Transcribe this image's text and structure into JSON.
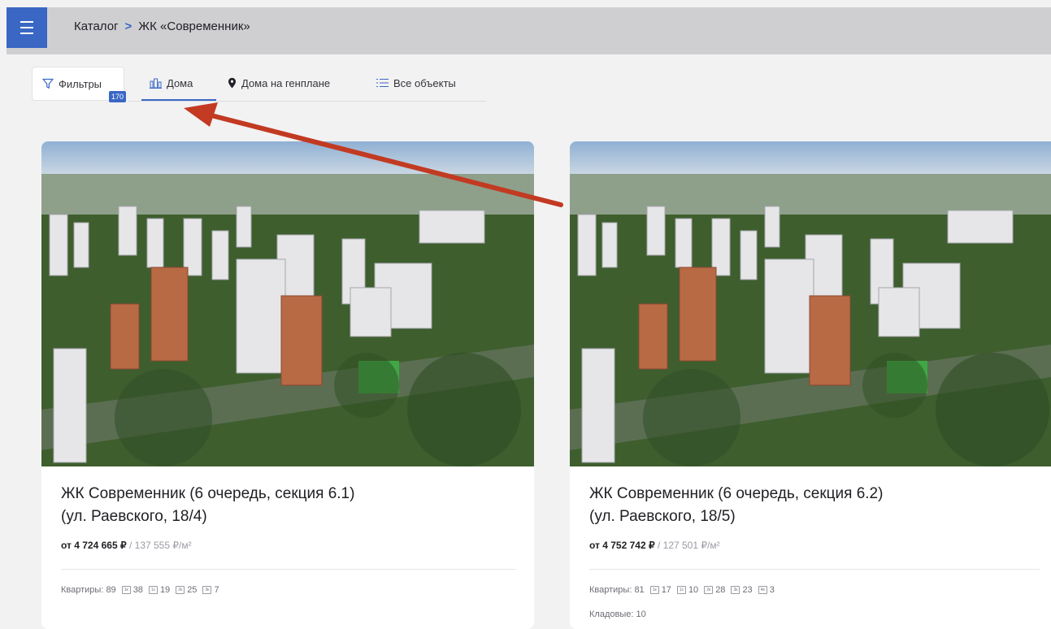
{
  "header": {
    "breadcrumb_catalog": "Каталог",
    "breadcrumb_separator": ">",
    "breadcrumb_current": "ЖК «Современник»"
  },
  "tabs": {
    "filters_label": "Фильтры",
    "filters_count": "170",
    "houses_label": "Дома",
    "genplan_label": "Дома на генплане",
    "all_objects_label": "Все объекты",
    "active_tab": "Дома"
  },
  "cards": [
    {
      "title_line1": "ЖК Современник (6 очередь, секция 6.1)",
      "title_line2": "(ул. Раевского, 18/4)",
      "price": "от 4 724 665 ₽",
      "price_sep": "/",
      "price_sqm": "137 555 ₽/м²",
      "apartments_label": "Квартиры: 89",
      "rooms": [
        {
          "type": "1к",
          "count": "38"
        },
        {
          "type": "1с",
          "count": "19"
        },
        {
          "type": "2к",
          "count": "25"
        },
        {
          "type": "3к",
          "count": "7"
        }
      ]
    },
    {
      "title_line1": "ЖК Современник (6 очередь, секция 6.2)",
      "title_line2": "(ул. Раевского, 18/5)",
      "price": "от 4 752 742 ₽",
      "price_sep": "/",
      "price_sqm": "127 501 ₽/м²",
      "apartments_label": "Квартиры: 81",
      "rooms": [
        {
          "type": "1к",
          "count": "17"
        },
        {
          "type": "1с",
          "count": "10"
        },
        {
          "type": "2к",
          "count": "28"
        },
        {
          "type": "3к",
          "count": "23"
        },
        {
          "type": "4к",
          "count": "3"
        }
      ],
      "storage_label": "Кладовые: 10"
    }
  ],
  "colors": {
    "accent": "#3a67c4",
    "arrow": "#c23a22",
    "header_bg": "#cfcfd2"
  }
}
